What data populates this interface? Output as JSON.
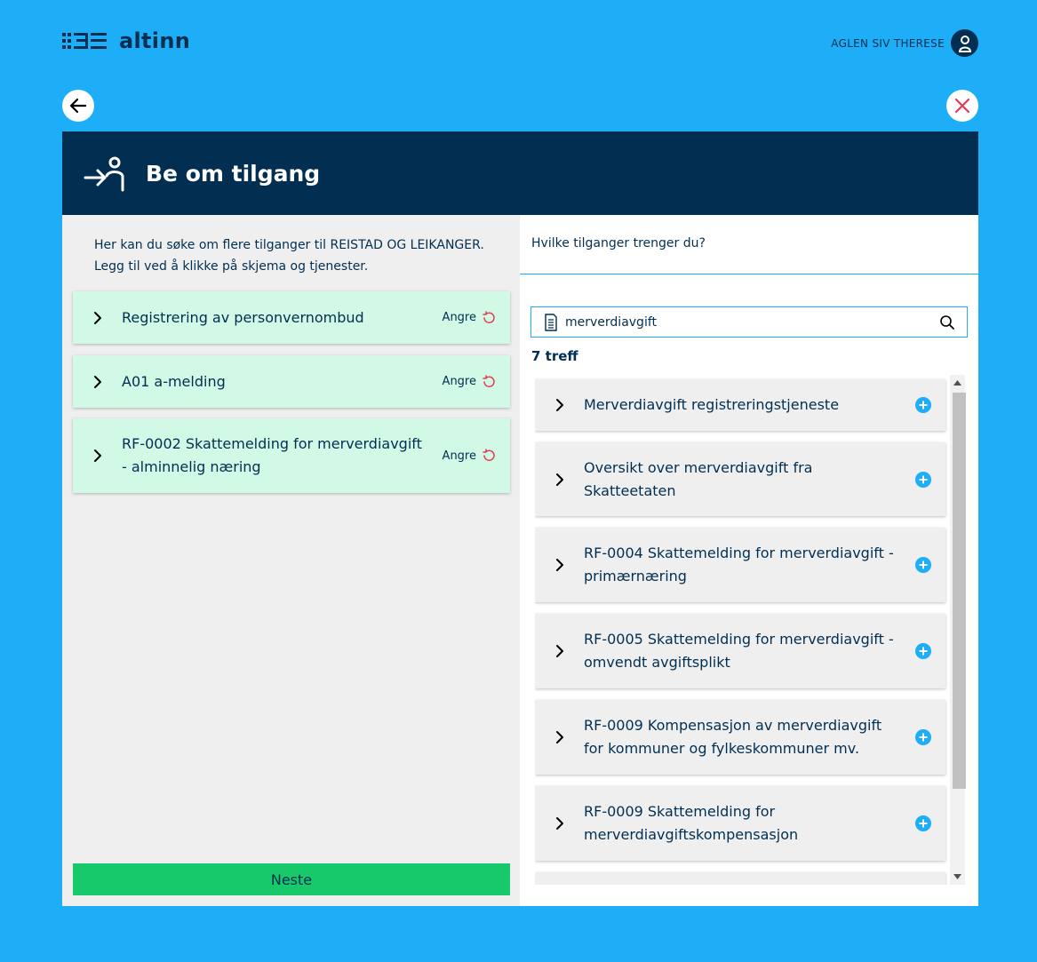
{
  "header": {
    "logo_text": "altinn",
    "user_name": "AGLEN SIV THERESE"
  },
  "modal": {
    "title": "Be om tilgang"
  },
  "left": {
    "intro_line1": "Her kan du søke om flere tilganger til REISTAD OG LEIKANGER.",
    "intro_line2": "Legg til ved å klikke på skjema og tjenester.",
    "undo_label": "Angre",
    "selected": [
      {
        "title": "Registrering av personvernombud"
      },
      {
        "title": "A01 a-melding"
      },
      {
        "title": "RF-0002 Skattemelding for merverdiavgift - alminnelig næring"
      }
    ],
    "next_label": "Neste"
  },
  "right": {
    "question": "Hvilke tilganger trenger du?",
    "search_value": "merverdiavgift",
    "hits": "7 treff",
    "results": [
      {
        "title": "Merverdiavgift registreringstjeneste"
      },
      {
        "title": "Oversikt over merverdiavgift fra Skatteetaten"
      },
      {
        "title": "RF-0004 Skattemelding for merverdiavgift - primærnæring"
      },
      {
        "title": "RF-0005 Skattemelding for merverdiavgift - omvendt avgiftsplikt"
      },
      {
        "title": "RF-0009 Kompensasjon av merverdiavgift for kommuner og fylkeskommuner mv."
      },
      {
        "title": "RF-0009 Skattemelding for merverdiavgiftskompensasjon"
      },
      {
        "title": ""
      }
    ]
  },
  "colors": {
    "background": "#1eaef7",
    "header_dark": "#022f51",
    "selected_card": "#d2f8e6",
    "next_button": "#17c96b",
    "add_icon": "#1eaef7",
    "undo_icon": "#e23b53"
  }
}
